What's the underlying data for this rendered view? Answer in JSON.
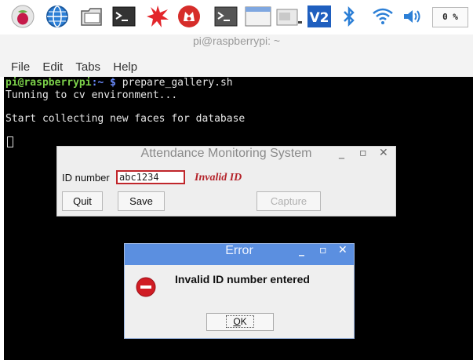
{
  "taskbar": {
    "icons": [
      "raspberry-icon",
      "globe-icon",
      "folder-icon",
      "terminal-icon",
      "burst-icon",
      "wolfram-icon",
      "terminal-icon",
      "window-icon",
      "window-minimized-icon",
      "vnc-icon",
      "bluetooth-icon",
      "wifi-icon",
      "volume-icon"
    ],
    "cpu_label": "0 %"
  },
  "terminal": {
    "window_title": "pi@raspberrypi: ~",
    "menu": [
      "File",
      "Edit",
      "Tabs",
      "Help"
    ],
    "prompt_user": "pi@raspberrypi",
    "prompt_sep": ":",
    "prompt_path": "~ $",
    "command": " prepare_gallery.sh",
    "line2": "Tunning to cv environment...",
    "line3": "Start collecting new faces for database"
  },
  "attendance_window": {
    "title": "Attendance Monitoring System",
    "controls": [
      "_",
      "▫",
      "✕"
    ],
    "id_label": "ID number",
    "id_value": "abc1234",
    "error_text": "Invalid ID",
    "buttons": {
      "quit": "Quit",
      "save": "Save",
      "capture": "Capture"
    }
  },
  "error_dialog": {
    "title": "Error",
    "controls": [
      "_",
      "▫",
      "✕"
    ],
    "message": "Invalid ID number entered",
    "ok_label": "OK",
    "ok_mnemonic": "O",
    "ok_rest": "K"
  },
  "colors": {
    "error_title_bar": "#5b8fe0",
    "invalid_text": "#b4232a",
    "error_icon": "#d01c24",
    "terminal_bg": "#000000",
    "prompt_user": "#7cd14a",
    "prompt_path": "#6b8cff"
  }
}
